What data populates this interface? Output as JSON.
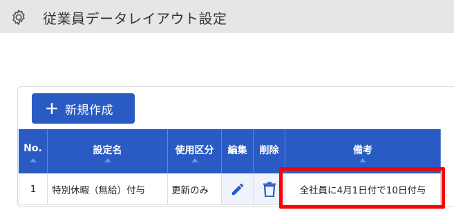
{
  "header": {
    "title": "従業員データレイアウト設定",
    "icon": "gear-icon"
  },
  "toolbar": {
    "new_button_label": "新規作成",
    "accent_color": "#2a5bc4"
  },
  "table": {
    "columns": [
      "No.",
      "設定名",
      "使用区分",
      "編集",
      "削除",
      "備考"
    ],
    "rows": [
      {
        "no": "1",
        "name": "特別休暇（無給）付与",
        "usage": "更新のみ",
        "edit_icon": "pencil-icon",
        "delete_icon": "trash-icon",
        "note": "全社員に4月1日付で10日付与"
      }
    ]
  },
  "annotation": {
    "highlight_color": "#ff0000"
  }
}
